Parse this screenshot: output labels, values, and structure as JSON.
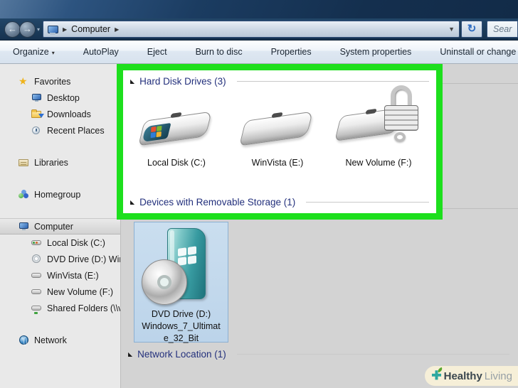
{
  "window": {
    "breadcrumb": "Computer",
    "search_text": "Sear"
  },
  "icons": {
    "back_arrow": "←",
    "forward_arrow": "→",
    "small_caret": "▾",
    "caret_down": "▼",
    "crumb_arrow": "▶",
    "refresh": "↻",
    "star": "★",
    "collapse_tri": "◣",
    "plus": "✚"
  },
  "toolbar": {
    "items": [
      "Organize",
      "AutoPlay",
      "Eject",
      "Burn to disc",
      "Properties",
      "System properties",
      "Uninstall or change a pr"
    ]
  },
  "sidebar": {
    "items": [
      {
        "label": "Favorites"
      },
      {
        "label": "Desktop"
      },
      {
        "label": "Downloads"
      },
      {
        "label": "Recent Places"
      },
      {
        "label": "Libraries"
      },
      {
        "label": "Homegroup"
      },
      {
        "label": "Computer"
      },
      {
        "label": "Local Disk (C:)"
      },
      {
        "label": "DVD Drive (D:) Windo"
      },
      {
        "label": "WinVista (E:)"
      },
      {
        "label": "New Volume (F:)"
      },
      {
        "label": "Shared Folders (\\\\vm"
      },
      {
        "label": "Network"
      }
    ]
  },
  "main": {
    "hard_disk_group": {
      "title": "Hard Disk Drives (3)",
      "drives": [
        {
          "label": "Local Disk (C:)"
        },
        {
          "label": "WinVista (E:)"
        },
        {
          "label": "New Volume (F:)"
        }
      ]
    },
    "removable_group": {
      "title": "Devices with Removable Storage (1)",
      "dvd": {
        "line1": "DVD Drive (D:)",
        "line2": "Windows_7_Ultimat",
        "line3": "e_32_Bit"
      }
    },
    "network_group": {
      "title": "Network Location (1)"
    }
  },
  "watermark": {
    "bold": "Healthy",
    "light": "Living"
  },
  "colors": {
    "highlight_green": "#1ddf1d",
    "titlebar_navy": "#16324f",
    "header_navy": "#23307c",
    "selection_blue": "#c3d9ee",
    "watermark_cream": "#f6efd8"
  }
}
